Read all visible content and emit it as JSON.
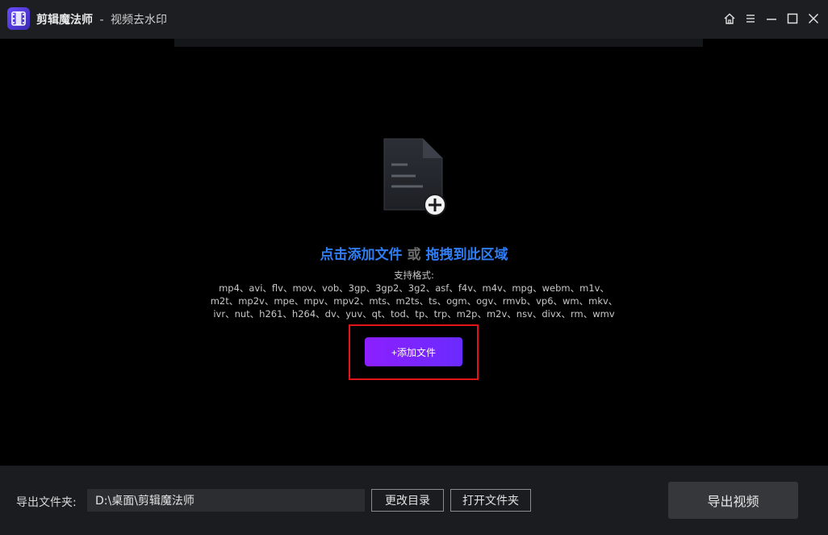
{
  "titlebar": {
    "app_name": "剪辑魔法师",
    "separator": "-",
    "subtitle": "视频去水印",
    "logo_icon": "film-strip-icon",
    "controls": [
      "home-icon",
      "menu-icon",
      "minimize-icon",
      "maximize-icon",
      "close-icon"
    ]
  },
  "drop_area": {
    "icon": "add-file-icon",
    "title_click": "点击添加文件",
    "title_or": "或",
    "title_drag": "拖拽到此区域",
    "formats_label": "支持格式:",
    "formats_lines": [
      "mp4、avi、flv、mov、vob、3gp、3gp2、3g2、asf、f4v、m4v、mpg、webm、m1v、",
      "m2t、mp2v、mpe、mpv、mpv2、mts、m2ts、ts、ogm、ogv、rmvb、vp6、wm、mkv、",
      "ivr、nut、h261、h264、dv、yuv、qt、tod、tp、trp、m2p、m2v、nsv、divx、rm、wmv"
    ],
    "add_button_label": "+添加文件"
  },
  "bottombar": {
    "export_folder_label": "导出文件夹:",
    "export_path": "D:\\桌面\\剪辑魔法师",
    "change_dir_label": "更改目录",
    "open_folder_label": "打开文件夹",
    "export_video_label": "导出视频"
  },
  "colors": {
    "accent_blue": "#2f7ef5",
    "button_purple": "#8c1fff",
    "highlight_red": "#e0141a"
  }
}
